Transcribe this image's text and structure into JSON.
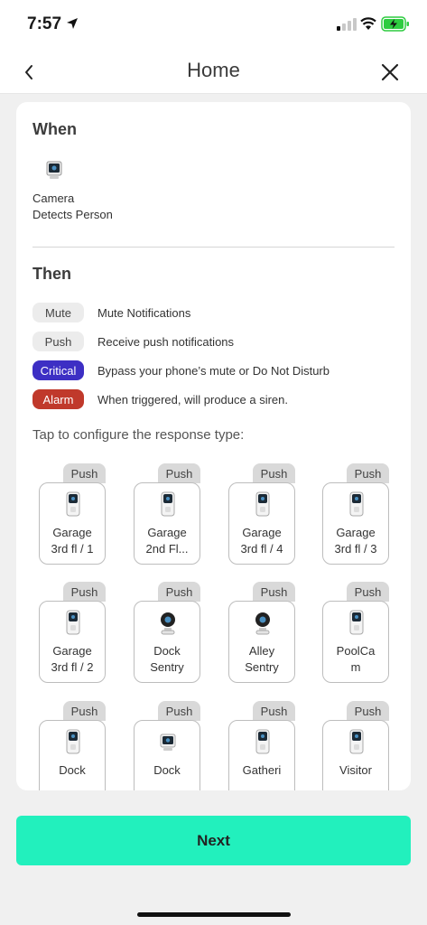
{
  "status_bar": {
    "time": "7:57"
  },
  "nav": {
    "title": "Home"
  },
  "when": {
    "title": "When",
    "trigger_line1": "Camera",
    "trigger_line2": "Detects Person"
  },
  "then": {
    "title": "Then",
    "legend": [
      {
        "tag": "Mute",
        "desc": "Mute Notifications",
        "color": "#ececec"
      },
      {
        "tag": "Push",
        "desc": "Receive push notifications",
        "color": "#ececec"
      },
      {
        "tag": "Critical",
        "desc": "Bypass your phone’s mute or Do Not Disturb",
        "color": "#3d2fc4"
      },
      {
        "tag": "Alarm",
        "desc": "When triggered, will produce a siren.",
        "color": "#c0392b"
      }
    ],
    "hint": "Tap to configure the response type:"
  },
  "devices": [
    {
      "badge": "Push",
      "line1": "Garage",
      "line2": "3rd fl / 1",
      "icon": "doorbell-icon"
    },
    {
      "badge": "Push",
      "line1": "Garage",
      "line2": "2nd Fl...",
      "icon": "doorbell-icon"
    },
    {
      "badge": "Push",
      "line1": "Garage",
      "line2": "3rd fl / 4",
      "icon": "doorbell-icon"
    },
    {
      "badge": "Push",
      "line1": "Garage",
      "line2": "3rd fl / 3",
      "icon": "doorbell-icon"
    },
    {
      "badge": "Push",
      "line1": "Garage",
      "line2": "3rd fl / 2",
      "icon": "doorbell-icon"
    },
    {
      "badge": "Push",
      "line1": "Dock",
      "line2": "Sentry",
      "icon": "cam-pan-icon"
    },
    {
      "badge": "Push",
      "line1": "Alley",
      "line2": "Sentry",
      "icon": "cam-pan-icon"
    },
    {
      "badge": "Push",
      "line1": "PoolCa",
      "line2": "m",
      "icon": "doorbell-icon"
    },
    {
      "badge": "Push",
      "line1": "Dock",
      "line2": "",
      "icon": "doorbell-icon"
    },
    {
      "badge": "Push",
      "line1": "Dock",
      "line2": "",
      "icon": "camera-icon"
    },
    {
      "badge": "Push",
      "line1": "Gatheri",
      "line2": "",
      "icon": "doorbell-icon"
    },
    {
      "badge": "Push",
      "line1": "Visitor",
      "line2": "",
      "icon": "doorbell-icon"
    }
  ],
  "footer": {
    "next_label": "Next",
    "accent": "#22f0bd"
  }
}
